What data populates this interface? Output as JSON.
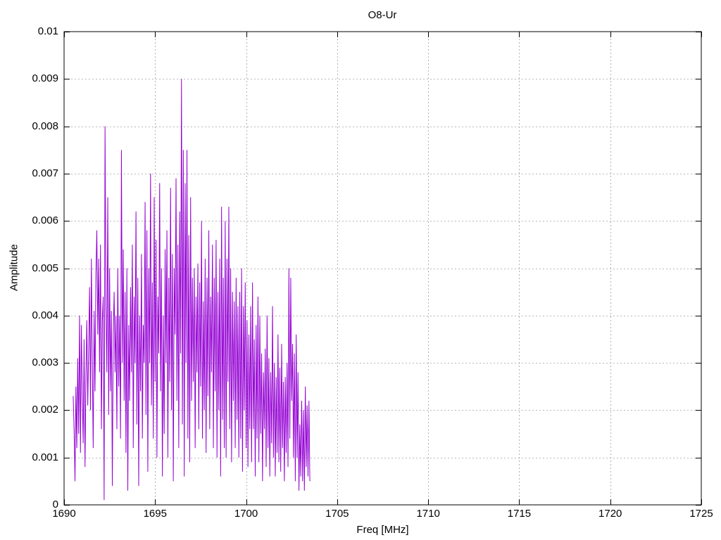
{
  "chart_data": {
    "type": "line",
    "title": "O8-Ur",
    "xlabel": "Freq [MHz]",
    "ylabel": "Amplitude",
    "xlim": [
      1690,
      1725
    ],
    "ylim": [
      0,
      0.01
    ],
    "x_ticks": [
      "1690",
      "1695",
      "1700",
      "1705",
      "1710",
      "1715",
      "1720",
      "1725"
    ],
    "y_ticks": [
      "0",
      "0.001",
      "0.002",
      "0.003",
      "0.004",
      "0.005",
      "0.006",
      "0.007",
      "0.008",
      "0.009",
      "0.01"
    ],
    "grid": true,
    "series": [
      {
        "name": "",
        "color": "#9400d3",
        "x_start": 1690.5,
        "x_step": 0.05,
        "values": [
          0.0023,
          0.0016,
          0.0005,
          0.0025,
          0.0012,
          0.0031,
          0.0015,
          0.004,
          0.0011,
          0.0038,
          0.0023,
          0.0013,
          0.0035,
          0.0008,
          0.0027,
          0.0039,
          0.0021,
          0.0033,
          0.0046,
          0.002,
          0.0052,
          0.003,
          0.0012,
          0.0041,
          0.0024,
          0.0049,
          0.0058,
          0.0036,
          0.0052,
          0.0028,
          0.0055,
          0.0016,
          0.0039,
          0.0044,
          0.0001,
          0.008,
          0.0042,
          0.0028,
          0.0065,
          0.0019,
          0.005,
          0.0024,
          0.0041,
          0.0004,
          0.0036,
          0.0045,
          0.0028,
          0.004,
          0.0016,
          0.005,
          0.0025,
          0.004,
          0.0014,
          0.0075,
          0.003,
          0.0054,
          0.0022,
          0.0045,
          0.0011,
          0.005,
          0.0003,
          0.0038,
          0.0022,
          0.0046,
          0.0028,
          0.0055,
          0.0012,
          0.0044,
          0.003,
          0.0062,
          0.0017,
          0.0048,
          0.0004,
          0.004,
          0.0024,
          0.0053,
          0.0014,
          0.0038,
          0.003,
          0.0064,
          0.0019,
          0.0058,
          0.0007,
          0.005,
          0.003,
          0.007,
          0.0021,
          0.0047,
          0.0014,
          0.0065,
          0.0026,
          0.0056,
          0.001,
          0.0044,
          0.0032,
          0.0068,
          0.0024,
          0.005,
          0.0006,
          0.004,
          0.0015,
          0.0054,
          0.003,
          0.0058,
          0.001,
          0.0048,
          0.0026,
          0.0067,
          0.002,
          0.0053,
          0.0005,
          0.005,
          0.0036,
          0.0069,
          0.0022,
          0.0055,
          0.0012,
          0.0062,
          0.0032,
          0.009,
          0.0017,
          0.0075,
          0.0006,
          0.0068,
          0.003,
          0.0075,
          0.0014,
          0.0057,
          0.0009,
          0.0065,
          0.0022,
          0.0048,
          0.0026,
          0.005,
          0.0012,
          0.0044,
          0.0028,
          0.0051,
          0.0016,
          0.0047,
          0.0025,
          0.006,
          0.0014,
          0.0043,
          0.002,
          0.0052,
          0.0011,
          0.0048,
          0.0023,
          0.0058,
          0.0016,
          0.0044,
          0.0028,
          0.0055,
          0.0012,
          0.0048,
          0.0024,
          0.0056,
          0.001,
          0.0045,
          0.002,
          0.0052,
          0.0006,
          0.0063,
          0.0018,
          0.0048,
          0.0012,
          0.006,
          0.001,
          0.0052,
          0.0026,
          0.0063,
          0.0016,
          0.005,
          0.0009,
          0.0045,
          0.0022,
          0.0043,
          0.0012,
          0.0048,
          0.0018,
          0.0042,
          0.001,
          0.0045,
          0.0014,
          0.005,
          0.0007,
          0.0042,
          0.002,
          0.0047,
          0.0012,
          0.0039,
          0.0008,
          0.0036,
          0.0016,
          0.0042,
          0.0009,
          0.0047,
          0.0016,
          0.0035,
          0.0006,
          0.0038,
          0.0014,
          0.0044,
          0.0009,
          0.004,
          0.0015,
          0.0032,
          0.0005,
          0.0028,
          0.0016,
          0.0033,
          0.0008,
          0.004,
          0.0012,
          0.0031,
          0.0006,
          0.0028,
          0.0013,
          0.0042,
          0.001,
          0.003,
          0.0006,
          0.0027,
          0.0011,
          0.0036,
          0.0009,
          0.0029,
          0.0007,
          0.0034,
          0.0012,
          0.0026,
          0.0005,
          0.0027,
          0.0011,
          0.003,
          0.0008,
          0.005,
          0.0014,
          0.0048,
          0.0022,
          0.0034,
          0.001,
          0.0032,
          0.0005,
          0.0036,
          0.001,
          0.0028,
          0.0003,
          0.0017,
          0.0006,
          0.0022,
          0.0005,
          0.002,
          0.0003,
          0.0025,
          0.0008,
          0.0021,
          0.0006,
          0.0022,
          0.0005
        ]
      }
    ]
  }
}
